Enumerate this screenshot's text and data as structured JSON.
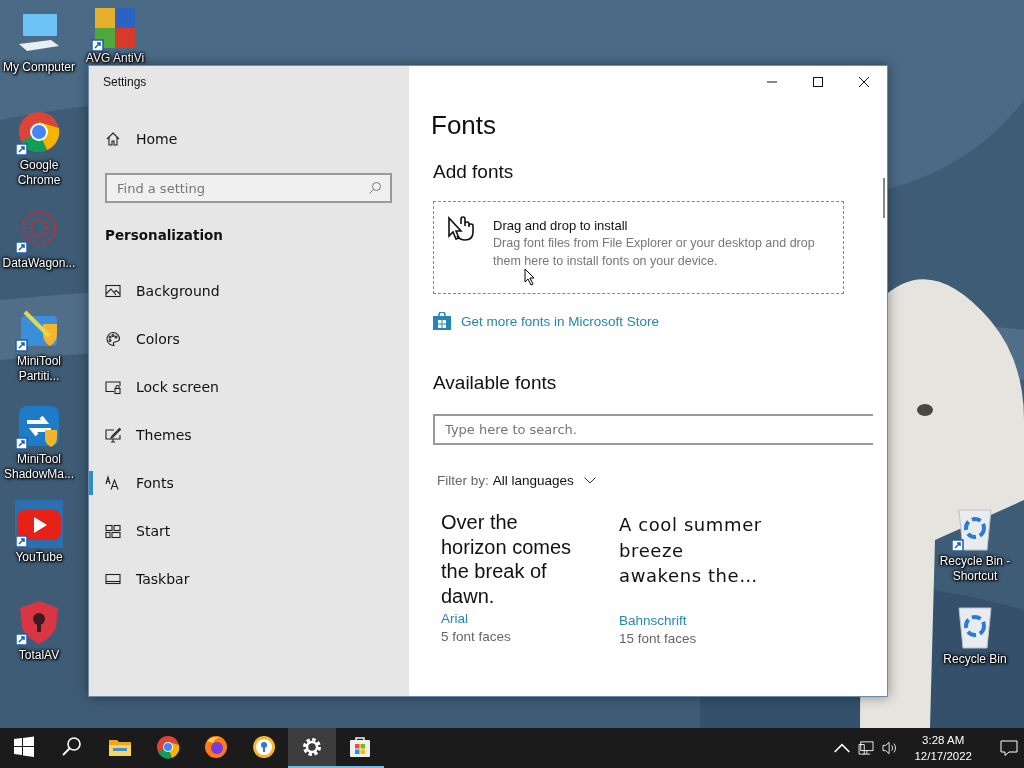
{
  "desktop": {
    "left_icons": [
      {
        "label": "My Computer",
        "kind": "computer",
        "shortcut": false
      },
      {
        "label": "Google Chrome",
        "kind": "chrome",
        "shortcut": true
      },
      {
        "label": "DataWagon...",
        "kind": "datawagon",
        "shortcut": true
      },
      {
        "label": "MiniTool Partiti...",
        "kind": "minitool",
        "shortcut": true
      },
      {
        "label": "MiniTool ShadowMa...",
        "kind": "shadowmaker",
        "shortcut": true
      },
      {
        "label": "YouTube",
        "kind": "youtube",
        "shortcut": true
      },
      {
        "label": "TotalAV",
        "kind": "totalav",
        "shortcut": true
      }
    ],
    "second_icons": [
      {
        "label": "AVG AntiVi",
        "kind": "avg",
        "shortcut": true
      }
    ],
    "right_icons": [
      {
        "label": "Recycle Bin - Shortcut",
        "kind": "recycle",
        "shortcut": true
      },
      {
        "label": "Recycle Bin",
        "kind": "recycle",
        "shortcut": false
      }
    ]
  },
  "window": {
    "title": "Settings",
    "sidebar": {
      "home": "Home",
      "search": {
        "placeholder": "Find a setting"
      },
      "section": "Personalization",
      "items": [
        {
          "label": "Background",
          "kind": "background",
          "selected": false
        },
        {
          "label": "Colors",
          "kind": "colors",
          "selected": false
        },
        {
          "label": "Lock screen",
          "kind": "lock",
          "selected": false
        },
        {
          "label": "Themes",
          "kind": "themes",
          "selected": false
        },
        {
          "label": "Fonts",
          "kind": "fonts",
          "selected": true
        },
        {
          "label": "Start",
          "kind": "start",
          "selected": false
        },
        {
          "label": "Taskbar",
          "kind": "taskbar",
          "selected": false
        }
      ]
    },
    "main": {
      "title": "Fonts",
      "add_heading": "Add fonts",
      "drop_zone": {
        "title": "Drag and drop to install",
        "description": "Drag font files from File Explorer or your desktop and drop them here to install fonts on your device."
      },
      "store_link": "Get more fonts in Microsoft Store",
      "available_heading": "Available fonts",
      "search": {
        "placeholder": "Type here to search."
      },
      "filter": {
        "label": "Filter by:",
        "value": "All languages"
      },
      "fonts": [
        {
          "sample": "Over the horizon comes the break of dawn.",
          "name": "Arial",
          "faces": "5 font faces",
          "kind": "sans"
        },
        {
          "sample": "A cool summer breeze awakens the…",
          "name": "Bahnschrift",
          "faces": "15 font faces",
          "kind": "condensed"
        }
      ]
    }
  },
  "taskbar": {
    "apps": [
      {
        "kind": "start",
        "open": false,
        "active": false
      },
      {
        "kind": "search",
        "open": false,
        "active": false
      },
      {
        "kind": "explorer",
        "open": false,
        "active": false
      },
      {
        "kind": "chrome",
        "open": false,
        "active": false
      },
      {
        "kind": "firefox",
        "open": false,
        "active": false
      },
      {
        "kind": "brave",
        "open": false,
        "active": false
      },
      {
        "kind": "settings",
        "open": true,
        "active": true
      },
      {
        "kind": "store",
        "open": true,
        "active": false
      }
    ],
    "time": "3:28 AM",
    "date": "12/17/2022"
  }
}
